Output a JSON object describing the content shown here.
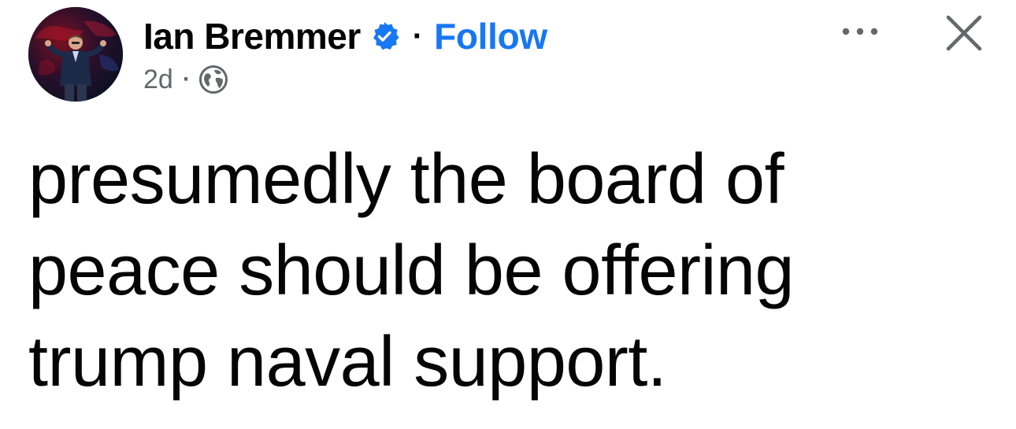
{
  "post": {
    "author": {
      "name": "Ian Bremmer",
      "verified": true,
      "avatar_icon": "profile-photo"
    },
    "separator": "·",
    "follow_label": "Follow",
    "timestamp": "2d",
    "meta_separator": "·",
    "audience_icon": "globe-icon",
    "more_icon": "more-options-icon",
    "close_icon": "close-icon",
    "text_lines": [
      "presumedly the board of",
      "peace should be offering",
      "trump naval support."
    ]
  },
  "colors": {
    "accent": "#1877f2",
    "text": "#050505",
    "secondary_text": "#65676b",
    "background": "#ffffff"
  }
}
